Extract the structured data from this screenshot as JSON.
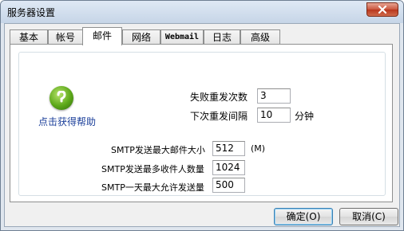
{
  "window": {
    "title": "服务器设置"
  },
  "tabs": [
    {
      "label": "基本",
      "active": false
    },
    {
      "label": "帐号",
      "active": false
    },
    {
      "label": "邮件",
      "active": true
    },
    {
      "label": "网络",
      "active": false
    },
    {
      "label": "Webmail",
      "active": false
    },
    {
      "label": "日志",
      "active": false
    },
    {
      "label": "高级",
      "active": false
    }
  ],
  "help": {
    "icon": "help-icon",
    "label": "点击获得帮助"
  },
  "retry": {
    "fail_count_label": "失败重发次数",
    "fail_count_value": "3",
    "interval_label": "下次重发间隔",
    "interval_value": "10",
    "interval_unit": "分钟"
  },
  "smtp": {
    "max_size_label": "SMTP发送最大邮件大小",
    "max_size_value": "512",
    "max_size_unit": "(M)",
    "max_recipients_label": "SMTP发送最多收件人数量",
    "max_recipients_value": "1024",
    "max_daily_label": "SMTP一天最大允许发送量",
    "max_daily_value": "500"
  },
  "buttons": {
    "ok": "确定(O)",
    "cancel": "取消(C)"
  },
  "colors": {
    "help_link": "#1b3f9a",
    "close_button": "#c9553d"
  }
}
